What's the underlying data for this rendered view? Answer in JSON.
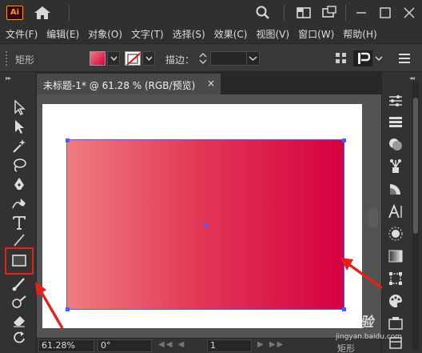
{
  "app": {
    "logo_text": "Ai"
  },
  "menu": [
    "文件(F)",
    "编辑(E)",
    "对象(O)",
    "文字(T)",
    "选择(S)",
    "效果(C)",
    "视图(V)",
    "窗口(W)",
    "帮助(H)"
  ],
  "control_bar": {
    "object_label": "矩形",
    "stroke_label": "描边：",
    "stroke_value": ""
  },
  "document": {
    "tab_title": "未标题-1* @ 61.28 % (RGB/预览)",
    "close_glyph": "×"
  },
  "status_bar": {
    "zoom": "61.28%",
    "rotation": "0°",
    "page": "1",
    "current_tool": "矩形"
  },
  "colors": {
    "gradient_start": "#ef7d81",
    "gradient_end": "#d7003f",
    "selection": "#4c5cff",
    "highlight_red": "#e8201a"
  },
  "watermark": {
    "text": "Bai度 经验",
    "sub": "jingyan.baidu.com"
  }
}
